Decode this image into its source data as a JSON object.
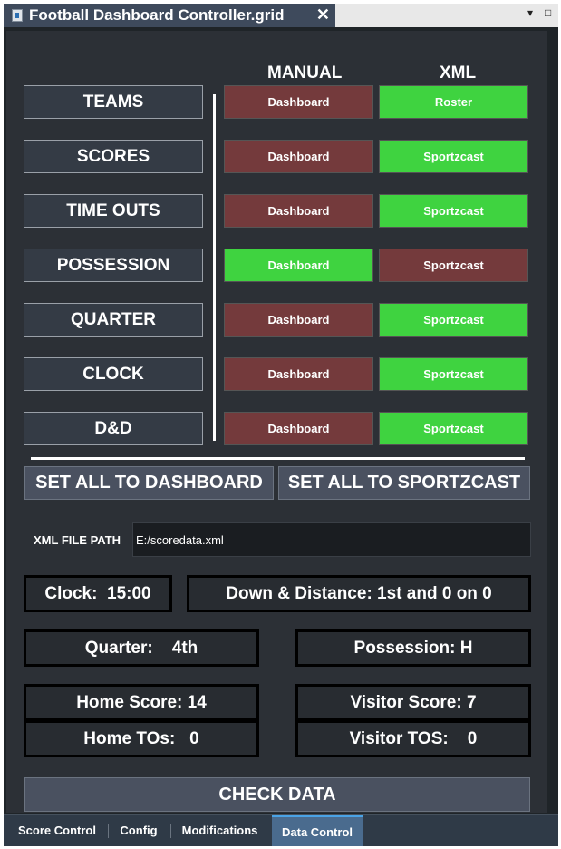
{
  "window": {
    "title": "Football Dashboard Controller.grid",
    "close_glyph": "✕",
    "minimize_glyph": "▾",
    "maximize_glyph": "□"
  },
  "headers": {
    "manual": "MANUAL",
    "xml": "XML"
  },
  "rows": [
    {
      "label": "TEAMS",
      "manual": "Dashboard",
      "xml": "Roster",
      "selected": "xml"
    },
    {
      "label": "SCORES",
      "manual": "Dashboard",
      "xml": "Sportzcast",
      "selected": "xml"
    },
    {
      "label": "TIME OUTS",
      "manual": "Dashboard",
      "xml": "Sportzcast",
      "selected": "xml"
    },
    {
      "label": "POSSESSION",
      "manual": "Dashboard",
      "xml": "Sportzcast",
      "selected": "manual"
    },
    {
      "label": "QUARTER",
      "manual": "Dashboard",
      "xml": "Sportzcast",
      "selected": "xml"
    },
    {
      "label": "CLOCK",
      "manual": "Dashboard",
      "xml": "Sportzcast",
      "selected": "xml"
    },
    {
      "label": "D&D",
      "manual": "Dashboard",
      "xml": "Sportzcast",
      "selected": "xml"
    }
  ],
  "actions": {
    "set_all_dashboard": "SET ALL TO DASHBOARD",
    "set_all_sportzcast": "SET ALL TO SPORTZCAST",
    "check_data": "CHECK DATA"
  },
  "xml_path": {
    "label": "XML FILE PATH",
    "value": "E:/scoredata.xml"
  },
  "info": {
    "clock": "Clock:  15:00",
    "down_distance": "Down & Distance: 1st and 0 on 0",
    "quarter": "Quarter:    4th",
    "possession": "Possession: H",
    "home_score": "Home Score: 14",
    "visitor_score": "Visitor Score: 7",
    "home_tos": "Home TOs:   0",
    "visitor_tos": "Visitor TOS:    0"
  },
  "bottom_tabs": [
    {
      "label": "Score Control",
      "active": false
    },
    {
      "label": "Config",
      "active": false
    },
    {
      "label": "Modifications",
      "active": false
    },
    {
      "label": "Data Control",
      "active": true
    }
  ],
  "colors": {
    "selected": "#3fd340",
    "unselected": "#743a3c",
    "panel": "#2c3036",
    "button": "#4a5160"
  }
}
